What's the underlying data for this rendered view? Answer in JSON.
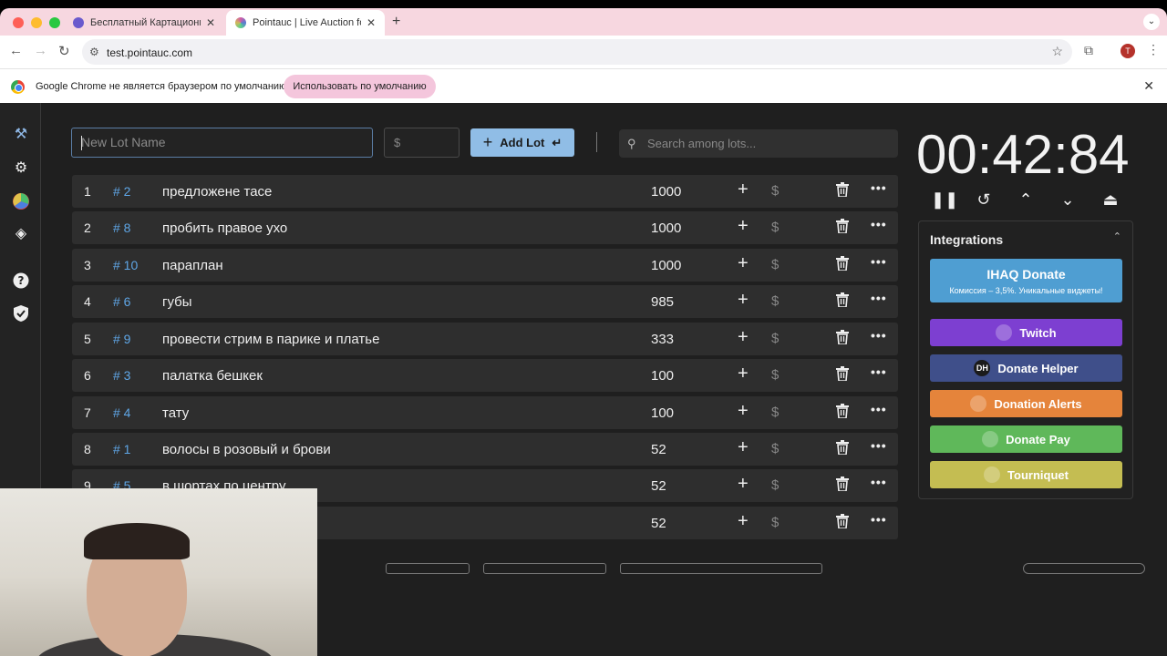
{
  "browser": {
    "tabs": [
      {
        "title": "Бесплатный Картационн: Раc",
        "active": false,
        "favicon_color": "#6a5acd"
      },
      {
        "title": "Pointauc | Live Auction for St",
        "active": true,
        "favicon_color": "#d25aa5"
      }
    ],
    "url": "test.pointauc.com",
    "profile_letter": "T",
    "infobar": {
      "message": "Google Chrome не является браузером по умолчанию.",
      "button": "Использовать по умолчанию"
    }
  },
  "lot_form": {
    "name_placeholder": "New Lot Name",
    "price_placeholder": "$",
    "add_button": "Add Lot",
    "search_placeholder": "Search among lots..."
  },
  "lots": [
    {
      "rank": "1",
      "id": "# 2",
      "name": "предложене тасе",
      "amount": "1000"
    },
    {
      "rank": "2",
      "id": "# 8",
      "name": "пробить правое ухо",
      "amount": "1000"
    },
    {
      "rank": "3",
      "id": "# 10",
      "name": "параплан",
      "amount": "1000"
    },
    {
      "rank": "4",
      "id": "# 6",
      "name": "губы",
      "amount": "985"
    },
    {
      "rank": "5",
      "id": "# 9",
      "name": "провести стрим в парике и платье",
      "amount": "333"
    },
    {
      "rank": "6",
      "id": "# 3",
      "name": "палатка бешкек",
      "amount": "100"
    },
    {
      "rank": "7",
      "id": "# 4",
      "name": "тату",
      "amount": "100"
    },
    {
      "rank": "8",
      "id": "# 1",
      "name": "волосы в розовый и брови",
      "amount": "52"
    },
    {
      "rank": "9",
      "id": "# 5",
      "name": "в шортах по центру",
      "amount": "52"
    },
    {
      "rank": "",
      "id": "",
      "name": "",
      "amount": "52"
    }
  ],
  "row_controls": {
    "plus": "+",
    "dollar": "$",
    "more": "•••"
  },
  "timer": {
    "display": "00:42:84"
  },
  "integrations": {
    "title": "Integrations",
    "ihaq": {
      "label": "IHAQ Donate",
      "subtitle": "Комиссия – 3,5%. Уникальные виджеты!"
    },
    "buttons": [
      {
        "label": "Twitch",
        "color": "#7d3fd1",
        "icon": "twitch-icon"
      },
      {
        "label": "Donate Helper",
        "color": "#3f4f8a",
        "icon": "dh-icon",
        "icon_text": "DH"
      },
      {
        "label": "Donation Alerts",
        "color": "#e5843b",
        "icon": "donationalerts-icon"
      },
      {
        "label": "Donate Pay",
        "color": "#5fb85a",
        "icon": "donatepay-icon"
      },
      {
        "label": "Tourniquet",
        "color": "#c4bd52",
        "icon": "tourniquet-icon"
      }
    ]
  },
  "colors": {
    "accent": "#90bde6",
    "link": "#5fa6e6",
    "row_bg": "#2e2e2e",
    "app_bg": "#1f1f1f"
  }
}
